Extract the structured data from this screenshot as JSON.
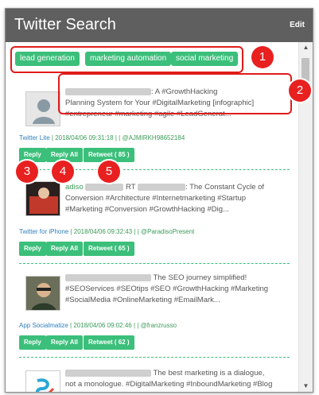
{
  "header": {
    "title": "Twitter Search",
    "edit_label": "Edit"
  },
  "tags": [
    "lead generation",
    "marketing automation",
    "social marketing"
  ],
  "tweets": [
    {
      "rt_prefix": "",
      "text_line1": ": A #GrowthHacking",
      "text_rest": "Planning System for Your #DigitalMarketing [infographic] #entrepreneur #marketing #agile #LeadGenerat...",
      "app": "Twitter Lite",
      "timestamp": "2018/04/06 09:31:18",
      "handle": "@AJMIRKH98652184",
      "retweet_label": "Retweet ( 85 )"
    },
    {
      "name_partial": "adiso",
      "rt_prefix": "RT",
      "text_line1": ": The Constant Cycle of",
      "text_rest": "Conversion #Architecture #Internetmarketing #Startup #Marketing #Conversion #GrowthHacking #Dig...",
      "app": "Twitter for iPhone",
      "timestamp": "2018/04/06 09:32:43",
      "handle": "@ParadisoPresent",
      "retweet_label": "Retweet ( 65 )"
    },
    {
      "rt_prefix": "",
      "text_line1": "The SEO journey simplified!",
      "text_rest": "#SEOServices #SEOtips #SEO #GrowthHacking #Marketing #SocialMedia #OnlineMarketing #EmailMark...",
      "app": "App Socialmatize",
      "timestamp": "2018/04/06 09:02:46",
      "handle": "@franzrusso",
      "retweet_label": "Retweet ( 62 )"
    },
    {
      "rt_prefix": "",
      "text_line1": "The best marketing is a dialogue,",
      "text_rest": "not a monologue. #DigitalMarketing #InboundMarketing #Blog"
    }
  ],
  "buttons": {
    "reply": "Reply",
    "reply_all": "Reply All"
  },
  "badges": [
    "1",
    "2",
    "3",
    "4",
    "5"
  ],
  "colors": {
    "titlebar": "#5f5f5f",
    "accent": "#3bbf7a",
    "annotation": "#e01b1b"
  }
}
